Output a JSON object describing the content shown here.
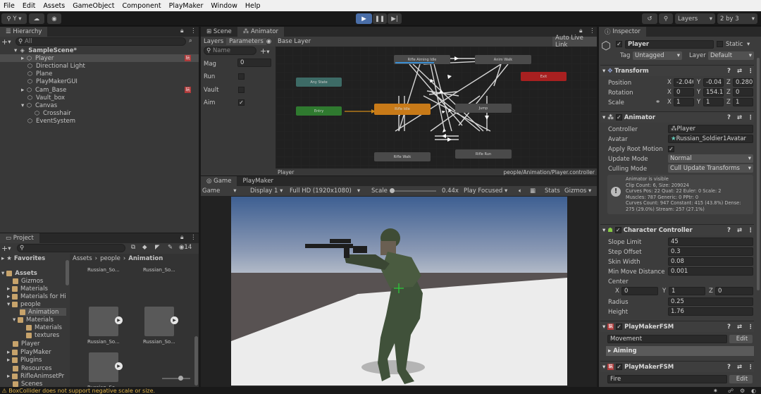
{
  "menu": [
    "File",
    "Edit",
    "Assets",
    "GameObject",
    "Component",
    "PlayMaker",
    "Window",
    "Help"
  ],
  "toolbar": {
    "account": "Y",
    "layers": "Layers",
    "layout": "2 by 3"
  },
  "hierarchy": {
    "tab": "Hierarchy",
    "search_placeholder": "All",
    "scene": "SampleScene*",
    "items": [
      "Player",
      "Directional Light",
      "Plane",
      "PlayMakerGUI",
      "Cam_Base",
      "Vault_box",
      "Canvas",
      "Crosshair",
      "EventSystem"
    ]
  },
  "project": {
    "tab": "Project",
    "count": "14",
    "tree": [
      "Favorites",
      "Assets",
      "Gizmos",
      "Materials",
      "Materials for Hi",
      "people",
      "Animation",
      "Materials",
      "Materials",
      "textures",
      "Player",
      "PlayMaker",
      "Plugins",
      "Resources",
      "RifleAnimsetPr",
      "Scenes"
    ],
    "breadcrumb": [
      "Assets",
      "people",
      "Animation"
    ],
    "files": [
      "Russian_So...",
      "Russian_So...",
      "Russian_So...",
      "Russian_So...",
      "Russian_So..."
    ]
  },
  "animator": {
    "tabs": [
      "Scene",
      "Animator"
    ],
    "subtabs": [
      "Layers",
      "Parameters"
    ],
    "layer": "Base Layer",
    "auto_live": "Auto Live Link",
    "search_placeholder": "Name",
    "params": [
      {
        "name": "Mag",
        "value": "0"
      },
      {
        "name": "Run",
        "value": ""
      },
      {
        "name": "Vault",
        "value": ""
      },
      {
        "name": "Aim",
        "value": "✓"
      }
    ],
    "nodes": {
      "aiming": "Rifle Aiming Idle",
      "walk": "Anim Walk",
      "exit": "Exit",
      "any": "Any State",
      "entry": "Entry",
      "idle": "Rifle Idle",
      "jump": "Jump",
      "rwalk": "Rifle Walk",
      "rrun": "Rifle Run"
    },
    "footer_left": "Player",
    "footer_right": "people/Animation/Player.controller"
  },
  "game": {
    "tabs": [
      "Game",
      "PlayMaker"
    ],
    "display_mode": "Game",
    "display": "Display 1",
    "resolution": "Full HD (1920x1080)",
    "scale_label": "Scale",
    "scale_value": "0.44x",
    "play_focused": "Play Focused",
    "stats": "Stats",
    "gizmos": "Gizmos"
  },
  "inspector": {
    "tab": "Inspector",
    "object": "Player",
    "static": "Static",
    "tag_label": "Tag",
    "tag": "Untagged",
    "layer_label": "Layer",
    "layer": "Default",
    "transform": {
      "title": "Transform",
      "position": "Position",
      "rotation": "Rotation",
      "scale": "Scale",
      "pos": [
        "-2.046",
        "-0.04",
        "0.280"
      ],
      "rot": [
        "0",
        "154.1İ",
        "0"
      ],
      "scl": [
        "1",
        "1",
        "1"
      ]
    },
    "animator": {
      "title": "Animator",
      "controller_label": "Controller",
      "controller": "Player",
      "avatar_label": "Avatar",
      "avatar": "Russian_Soldier1Avatar",
      "root_motion": "Apply Root Motion",
      "update_label": "Update Mode",
      "update": "Normal",
      "culling_label": "Culling Mode",
      "culling": "Cull Update Transforms",
      "info": [
        "Animator is visible",
        "Clip Count: 6, Size: 209024",
        "Curves Pos: 22 Quat: 22 Euler: 0 Scale: 2",
        "Muscles: 787 Generic: 0 PPtr: 0",
        "Curves Count: 947 Constant: 415 (43.8%) Dense:",
        "275 (29.0%) Stream: 257 (27.1%)"
      ]
    },
    "cc": {
      "title": "Character Controller",
      "slope_label": "Slope Limit",
      "slope": "45",
      "step_label": "Step Offset",
      "step": "0.3",
      "skin_label": "Skin Width",
      "skin": "0.08",
      "minmove_label": "Min Move Distance",
      "minmove": "0.001",
      "center_label": "Center",
      "center": [
        "0",
        "1",
        "0"
      ],
      "radius_label": "Radius",
      "radius": "0.25",
      "height_label": "Height",
      "height": "1.76"
    },
    "fsm1": {
      "title": "PlayMakerFSM",
      "name": "Movement",
      "edit": "Edit",
      "state": "Aiming"
    },
    "fsm2": {
      "title": "PlayMakerFSM",
      "name": "Fire",
      "edit": "Edit"
    }
  },
  "status": "BoxCollider does not support negative scale or size."
}
